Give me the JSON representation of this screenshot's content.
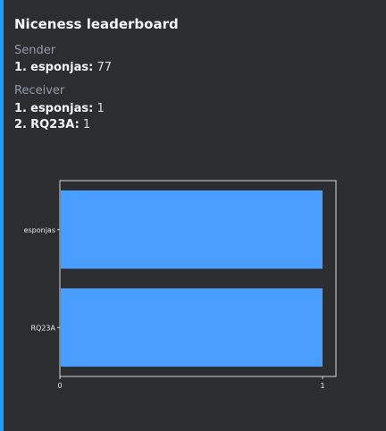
{
  "embed": {
    "accent_color": "#1f9ef4",
    "title": "Niceness leaderboard",
    "sender": {
      "label": "Sender",
      "entries": [
        {
          "rank": "1.",
          "name": "esponjas:",
          "value": "77"
        }
      ]
    },
    "receiver": {
      "label": "Receiver",
      "entries": [
        {
          "rank": "1.",
          "name": "esponjas:",
          "value": "1"
        },
        {
          "rank": "2.",
          "name": "RQ23A:",
          "value": "1"
        }
      ]
    }
  },
  "chart_data": {
    "type": "bar",
    "orientation": "horizontal",
    "categories": [
      "esponjas",
      "RQ23A"
    ],
    "values": [
      1,
      1
    ],
    "xlim": [
      0,
      1
    ],
    "xticks": [
      "0",
      "1"
    ],
    "bar_color": "#4a9eff",
    "grid": false,
    "title": "",
    "xlabel": "",
    "ylabel": ""
  }
}
